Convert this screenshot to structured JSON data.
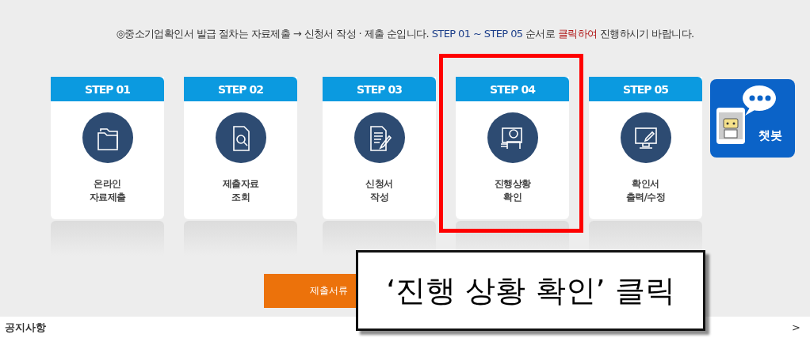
{
  "intro": [
    {
      "kind": "plain",
      "text": "◎중소기업확인서 발급 절차는 자료제출 → 신청서 작성 · 제출 순입니다. "
    },
    {
      "kind": "step",
      "text": "STEP 01 ~ STEP 05"
    },
    {
      "kind": "plain",
      "text": " 순서로 "
    },
    {
      "kind": "emph",
      "text": "클릭하여"
    },
    {
      "kind": "plain",
      "text": " 진행하시기 바랍니다."
    }
  ],
  "steps": [
    {
      "step": "STEP 01",
      "kind": "folder",
      "lines": [
        "온라인",
        "자료제출"
      ],
      "selected": false
    },
    {
      "step": "STEP 02",
      "kind": "search",
      "lines": [
        "제출자료",
        "조회"
      ],
      "selected": false
    },
    {
      "step": "STEP 03",
      "kind": "write",
      "lines": [
        "신청서",
        "작성"
      ],
      "selected": false
    },
    {
      "step": "STEP 04",
      "kind": "person",
      "lines": [
        "진행상황",
        "확인"
      ],
      "selected": true
    },
    {
      "step": "STEP 05",
      "kind": "monitor",
      "lines": [
        "확인서",
        "출력/수정"
      ],
      "selected": false
    }
  ],
  "chatbot": {
    "label": "챗봇"
  },
  "submit_button": {
    "label": "제출서류"
  },
  "callout": {
    "text": "‘진행 상황 확인’ 클릭"
  },
  "notice": {
    "title": "공지사항",
    "arrow": ">"
  }
}
